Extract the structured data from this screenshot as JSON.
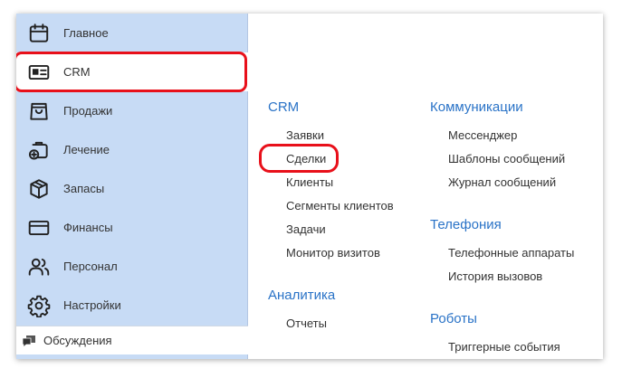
{
  "sidebar": {
    "items": [
      {
        "label": "Главное",
        "icon": "calendar-icon"
      },
      {
        "label": "CRM",
        "icon": "id-card-icon"
      },
      {
        "label": "Продажи",
        "icon": "shopping-bag-icon"
      },
      {
        "label": "Лечение",
        "icon": "medical-kit-icon"
      },
      {
        "label": "Запасы",
        "icon": "box-icon"
      },
      {
        "label": "Финансы",
        "icon": "credit-card-icon"
      },
      {
        "label": "Персонал",
        "icon": "people-icon"
      },
      {
        "label": "Настройки",
        "icon": "gear-icon"
      }
    ],
    "footer_label": "Обсуждения",
    "footer_icon": "chat-bubble-icon"
  },
  "menu": {
    "crm": {
      "title": "CRM",
      "links": [
        "Заявки",
        "Сделки",
        "Клиенты",
        "Сегменты клиентов",
        "Задачи",
        "Монитор визитов"
      ]
    },
    "analytics": {
      "title": "Аналитика",
      "links": [
        "Отчеты"
      ]
    },
    "communications": {
      "title": "Коммуникации",
      "links": [
        "Мессенджер",
        "Шаблоны сообщений",
        "Журнал сообщений"
      ]
    },
    "telephony": {
      "title": "Телефония",
      "links": [
        "Телефонные аппараты",
        "История вызовов"
      ]
    },
    "robots": {
      "title": "Роботы",
      "links": [
        "Триггерные события"
      ]
    }
  },
  "colors": {
    "sidebar_bg": "#c7dbf5",
    "section_title": "#2a73c7",
    "highlight": "#e8101a"
  }
}
